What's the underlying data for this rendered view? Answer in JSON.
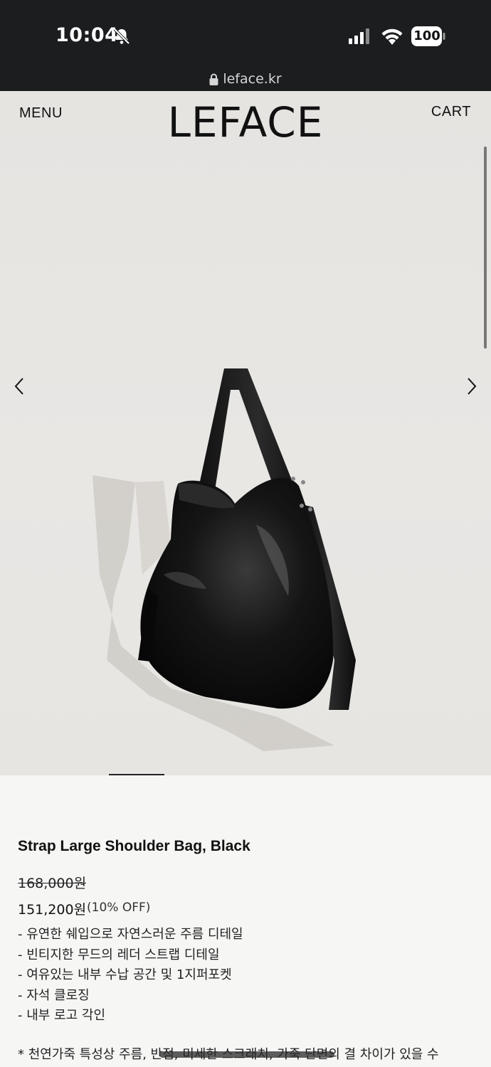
{
  "status_bar": {
    "time": "10:04",
    "battery": "100",
    "url": "leface.kr"
  },
  "header": {
    "menu_label": "MENU",
    "logo": "LEFACE",
    "cart_label": "CART"
  },
  "product": {
    "title": "Strap Large Shoulder Bag, Black",
    "original_price": "168,000원",
    "sale_price": "151,200원",
    "discount": "(10% OFF)",
    "features": [
      "- 유연한 쉐입으로 자연스러운 주름 디테일",
      "- 빈티지한 무드의 레더 스트랩 디테일",
      "- 여유있는 내부 수납 공간 및 1지퍼포켓",
      "- 자석 클로징",
      "- 내부 로고 각인"
    ],
    "notice": "* 천연가죽 특성상 주름, 반점, 미세한 스크래치, 가죽 단면의 결 차이가 있을 수"
  },
  "icons": {
    "prev": "chevron-left-icon",
    "next": "chevron-right-icon",
    "lock": "lock-icon",
    "notifications_off": "bell-slash-icon",
    "signal": "cellular-signal-icon",
    "wifi": "wifi-icon",
    "battery": "battery-icon"
  },
  "colors": {
    "status_bar_bg": "#1b1d1f",
    "hero_bg": "#e8e6e3",
    "page_bg": "#f6f6f5",
    "text": "#111111"
  }
}
